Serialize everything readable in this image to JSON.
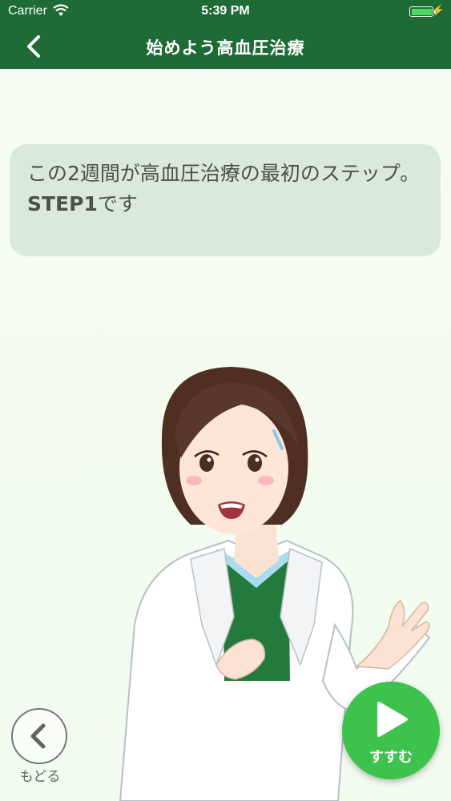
{
  "status_bar": {
    "carrier": "Carrier",
    "time": "5:39 PM",
    "battery_level": 1.0
  },
  "nav": {
    "title": "始めよう高血圧治療"
  },
  "speech": {
    "text": "この2週間が高血圧治療の最初のステップ。",
    "step_text": "STEP1",
    "suffix": "です"
  },
  "controls": {
    "back_label": "もどる",
    "next_label": "すすむ"
  },
  "icons": [
    "wifi-icon",
    "battery-icon",
    "charging-bolt-icon",
    "chevron-left-icon",
    "play-icon"
  ],
  "colors": {
    "header": "#1e6b36",
    "next_button": "#3ec24e",
    "speech_bubble": "#dbe8dc",
    "background": "#f4fcf1"
  }
}
